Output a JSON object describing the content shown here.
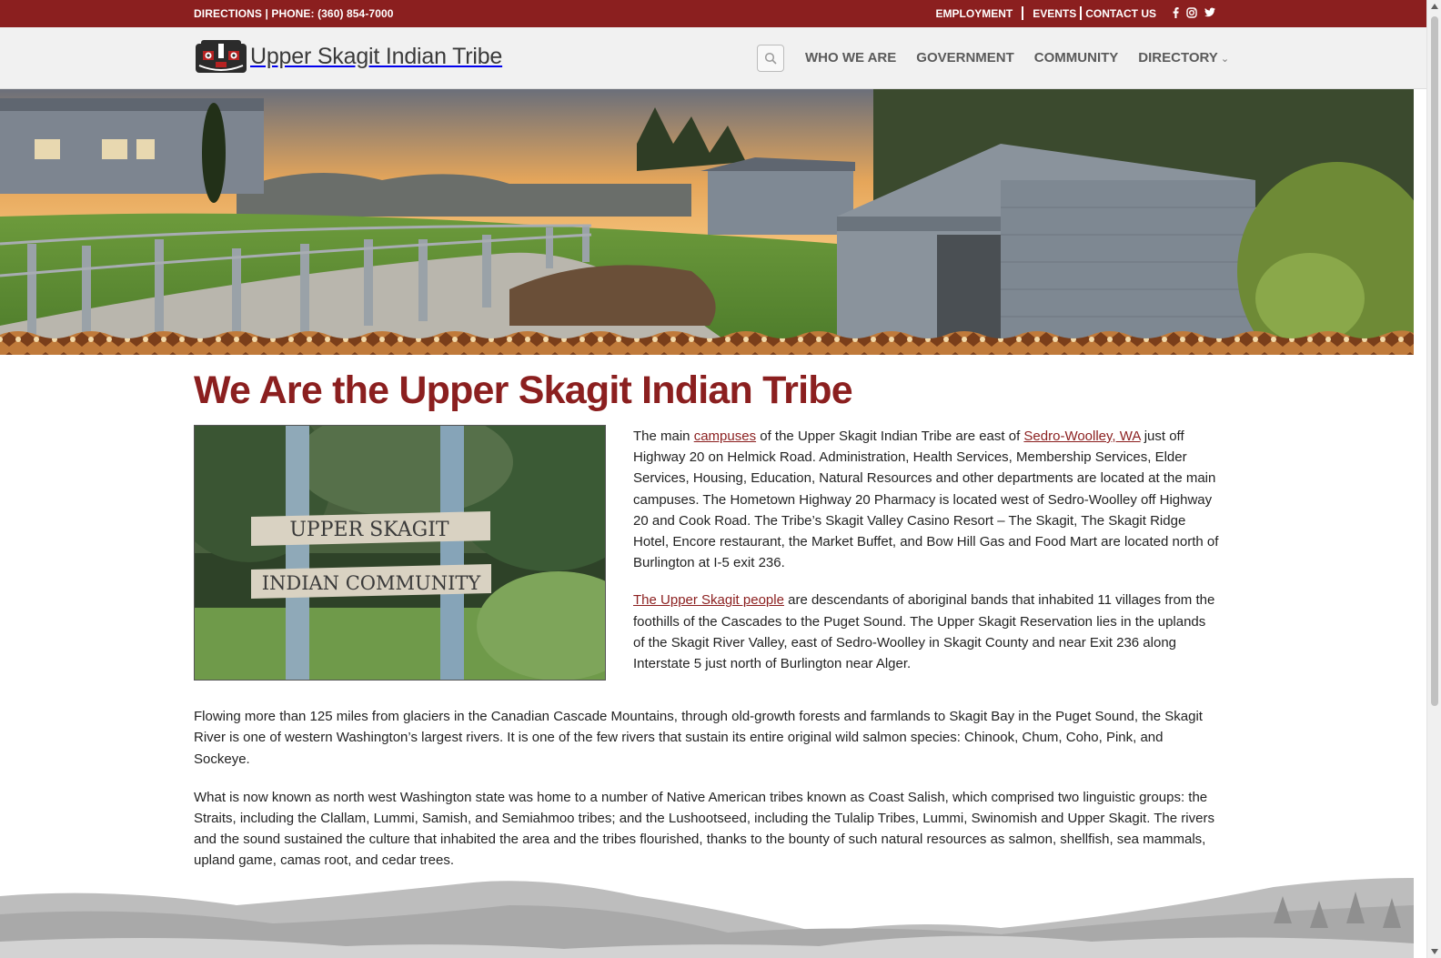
{
  "topbar": {
    "directions": "DIRECTIONS",
    "phone": "PHONE: (360) 854-7000",
    "employment": "EMPLOYMENT",
    "events": "EVENTS",
    "contact": "CONTACT US",
    "social_icons": [
      "facebook-icon",
      "instagram-icon",
      "twitter-icon"
    ],
    "color": "#8b1f1f"
  },
  "header": {
    "logo_text": "Upper Skagit Indian Tribe",
    "nav": [
      "WHO WE ARE",
      "GOVERNMENT",
      "COMMUNITY",
      "DIRECTORY"
    ]
  },
  "main": {
    "title": "We Are the Upper Skagit Indian Tribe",
    "sign_line1": "UPPER SKAGIT",
    "sign_line2": "INDIAN COMMUNITY",
    "p1": {
      "pre": "The main ",
      "link1": "campuses",
      "mid": " of the Upper Skagit Indian Tribe are east of ",
      "link2": "Sedro-Woolley, WA",
      "post": " just off Highway 20 on Helmick Road. Administration, Health Services, Membership Services, Elder Services, Housing, Education, Natural Resources and other departments are located at the main campuses. The Hometown Highway 20 Pharmacy is located west of Sedro-Woolley off Highway 20 and Cook Road. The Tribe’s Skagit Valley Casino Resort – The Skagit, The Skagit Ridge Hotel, Encore restaurant, the Market Buffet, and Bow Hill Gas and Food Mart are located north of Burlington at I-5 exit 236."
    },
    "p2": {
      "link": "The Upper Skagit people",
      "post": " are descendants of aboriginal bands that inhabited 11 villages from the foothills of the Cascades to the Puget Sound. The Upper Skagit Reservation lies in the uplands of the Skagit River Valley, east of Sedro-Woolley in Skagit County and near Exit 236 along Interstate 5 just north of Burlington near Alger."
    },
    "p3": "Flowing more than 125 miles from glaciers in the Canadian Cascade Mountains, through old-growth forests and farmlands to Skagit Bay in the Puget Sound, the Skagit River is one of western Washington’s largest rivers. It is one of the few rivers that sustain its entire original wild salmon species: Chinook, Chum, Coho, Pink, and Sockeye.",
    "p4": "What is now known as north west Washington state was home to a number of Native American tribes known as Coast Salish, which comprised two linguistic groups: the Straits, including the Clallam, Lummi, Samish, and Semiahmoo tribes; and the Lushootseed, including the Tulalip Tribes, Lummi, Swinomish and Upper Skagit. The rivers and the sound sustained the culture that inhabited the area and the tribes flourished, thanks to the bounty of such natural resources as salmon, shellfish, sea mammals, upland game, camas root, and cedar trees."
  }
}
